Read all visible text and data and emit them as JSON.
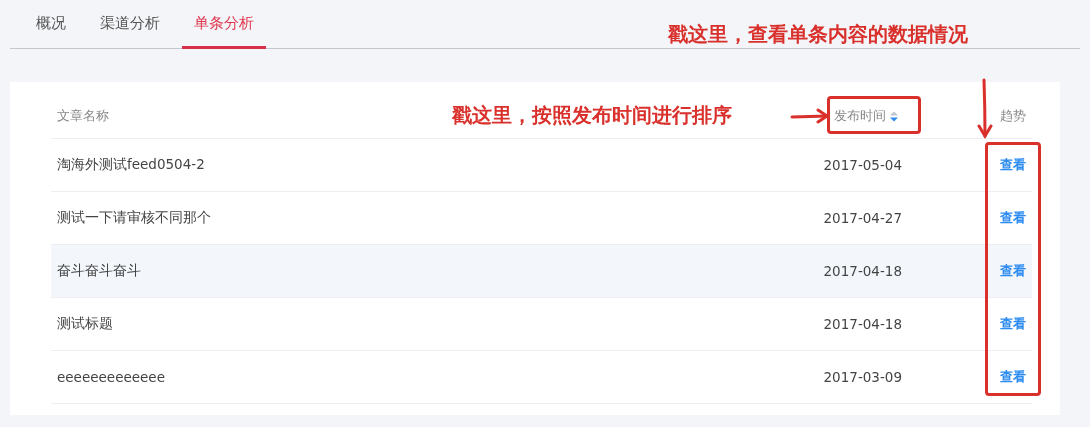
{
  "tabs": [
    {
      "label": "概况",
      "selected": false
    },
    {
      "label": "渠道分析",
      "selected": false
    },
    {
      "label": "单条分析",
      "selected": true
    }
  ],
  "table": {
    "columns": [
      {
        "label": "文章名称",
        "sortable": false
      },
      {
        "label": "发布时间",
        "sortable": true,
        "sort_descending": true
      },
      {
        "label": "趋势",
        "sortable": false
      }
    ],
    "rows": [
      {
        "title": "淘海外测试feed0504-2",
        "date": "2017-05-04",
        "action": "查看",
        "hovered": false
      },
      {
        "title": "测试一下请审核不同那个",
        "date": "2017-04-27",
        "action": "查看",
        "hovered": false
      },
      {
        "title": "奋斗奋斗奋斗",
        "date": "2017-04-18",
        "action": "查看",
        "hovered": true
      },
      {
        "title": "测试标题",
        "date": "2017-04-18",
        "action": "查看",
        "hovered": false
      },
      {
        "title": "eeeeeeeeeeeee",
        "date": "2017-03-09",
        "action": "查看",
        "hovered": false
      }
    ]
  },
  "annotations": [
    {
      "kind": "trend",
      "text": "戳这里，查看单条内容的数据情况"
    },
    {
      "kind": "sort",
      "text": "戳这里，按照发布时间进行排序"
    }
  ]
}
